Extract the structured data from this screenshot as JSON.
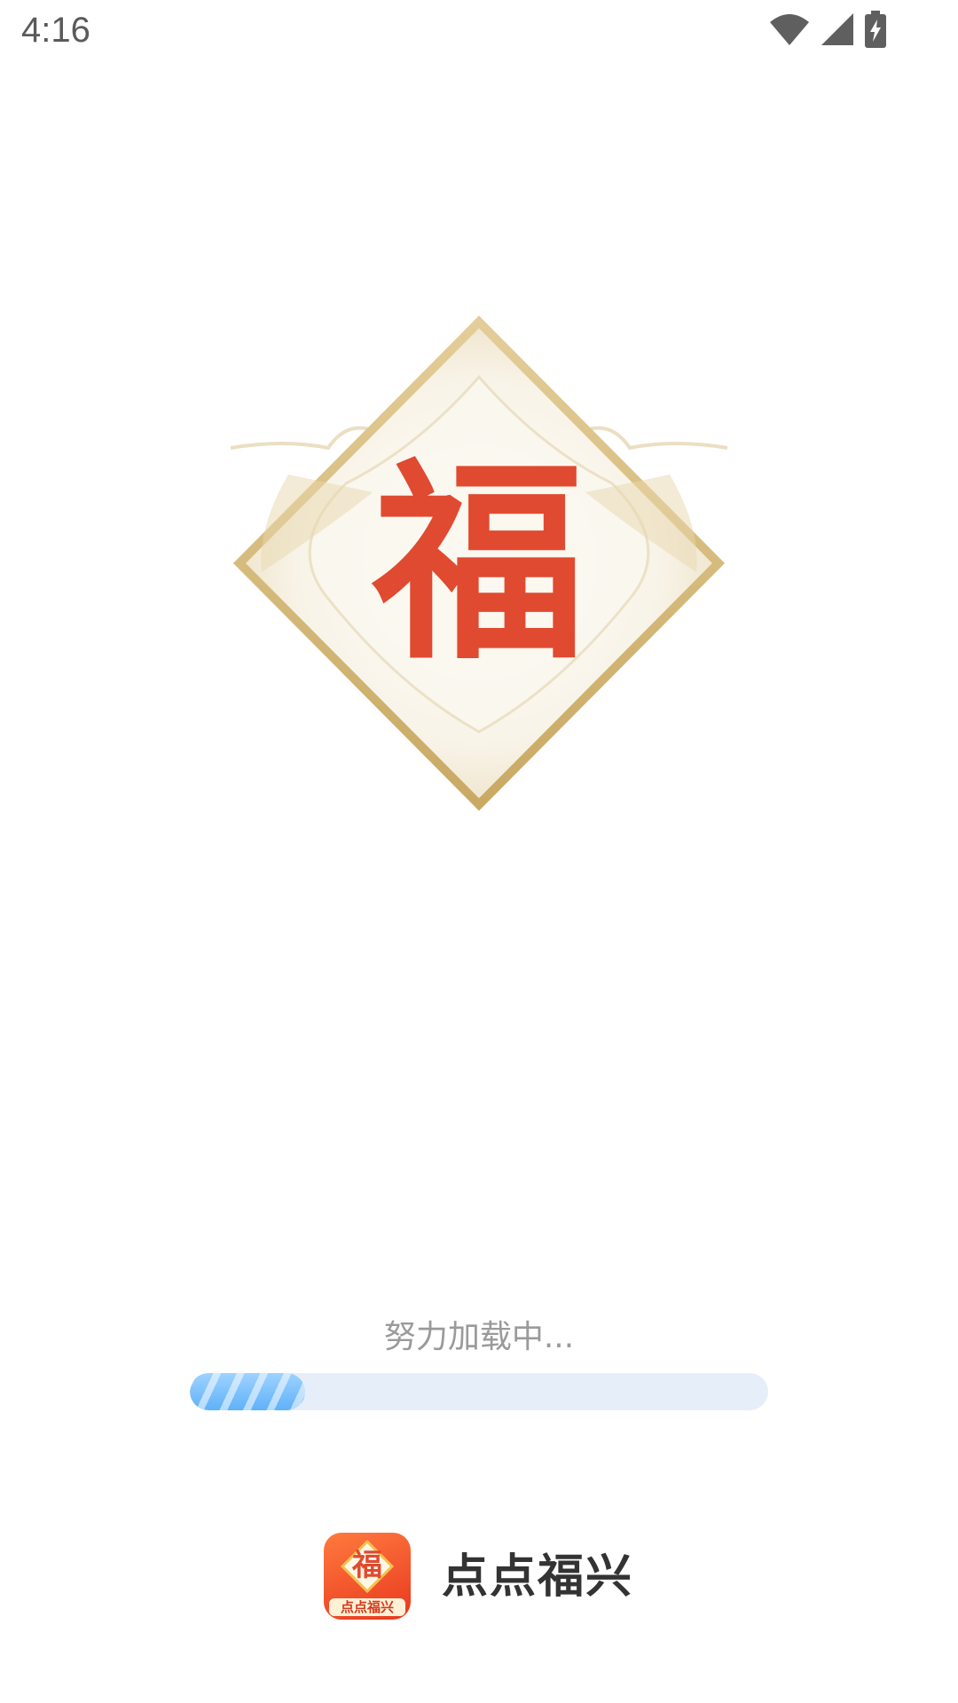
{
  "status_bar": {
    "time": "4:16",
    "icons": [
      "wifi-icon",
      "cellular-signal-icon",
      "battery-charging-icon"
    ]
  },
  "splash": {
    "emblem_character": "福",
    "emblem_colors": {
      "character": "#e04a30",
      "frame": "#d4b57a",
      "fill": "#f7f2e6"
    }
  },
  "loading": {
    "text": "努力加载中...",
    "progress": 0.2,
    "track_color": "#e6eef9",
    "fill_color": "#6cb8f8"
  },
  "brand": {
    "logo_character": "福",
    "logo_caption": "点点福兴",
    "name": "点点福兴",
    "logo_color": "#ee4a28"
  }
}
